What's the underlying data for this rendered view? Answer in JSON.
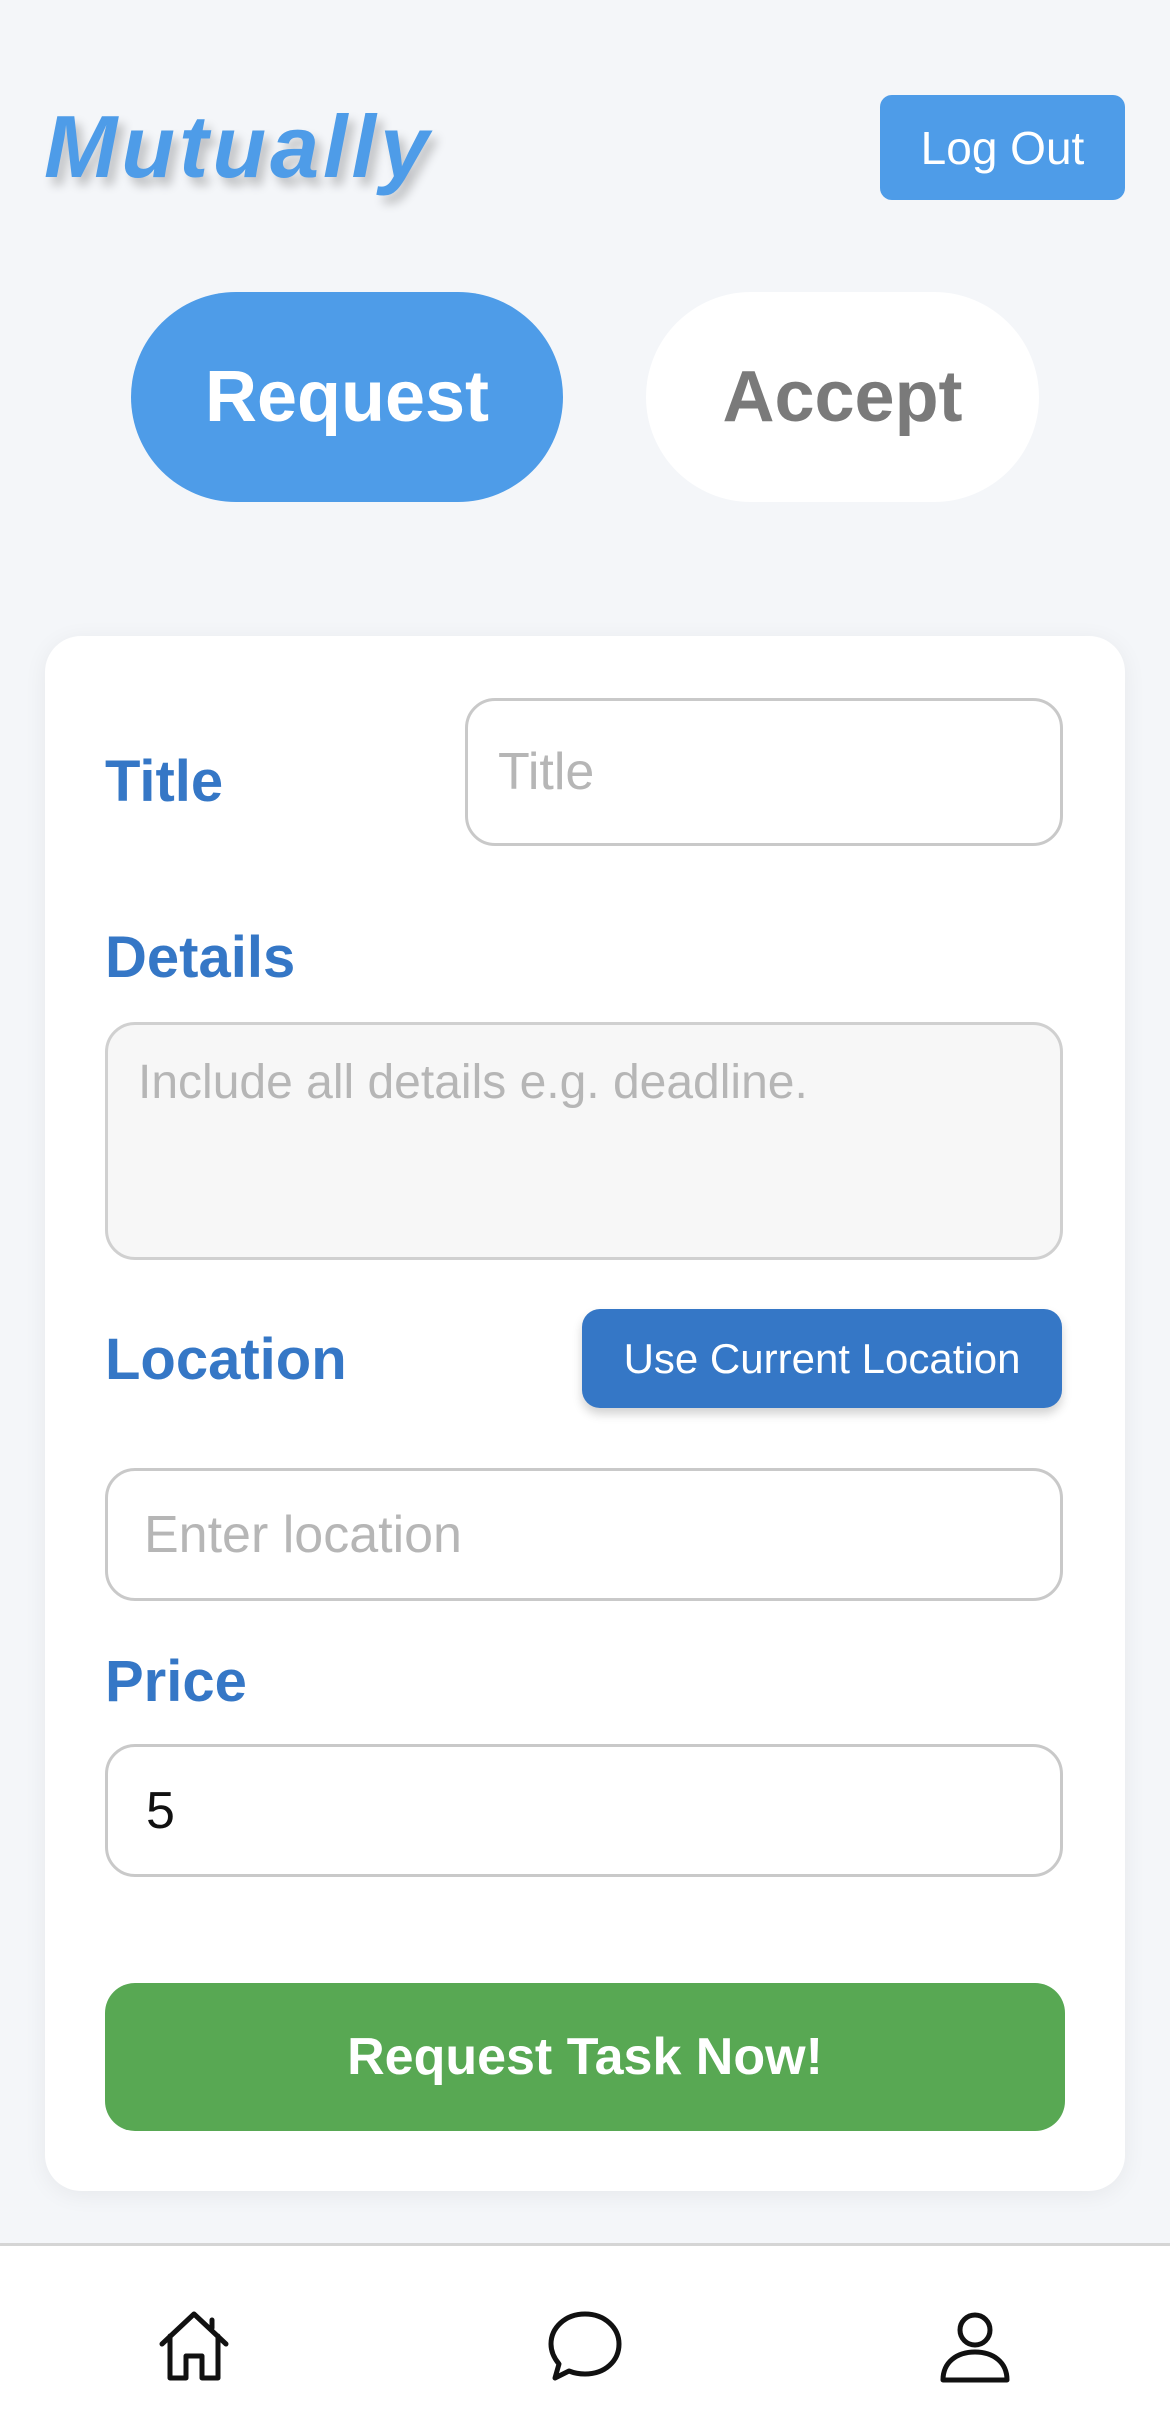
{
  "header": {
    "app_title": "Mutually",
    "logout_label": "Log Out"
  },
  "mode_tabs": [
    {
      "label": "Request",
      "active": true
    },
    {
      "label": "Accept",
      "active": false
    }
  ],
  "form": {
    "title_label": "Title",
    "title_placeholder": "Title",
    "details_label": "Details",
    "details_placeholder": "Include all details e.g. deadline.",
    "location_label": "Location",
    "use_location_label": "Use Current Location",
    "location_placeholder": "Enter location",
    "price_label": "Price",
    "price_value": "5",
    "submit_label": "Request Task Now!"
  },
  "bottom_nav": [
    {
      "icon": "home-icon"
    },
    {
      "icon": "chat-icon"
    },
    {
      "icon": "profile-icon"
    }
  ],
  "colors": {
    "accent": "#4e9ce8",
    "label_blue": "#3577c6",
    "submit_green": "#58a853",
    "background": "#f4f6f9"
  }
}
